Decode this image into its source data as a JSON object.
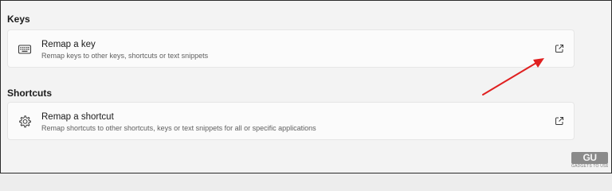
{
  "sections": {
    "keys": {
      "header": "Keys",
      "card": {
        "title": "Remap a key",
        "subtitle": "Remap keys to other keys, shortcuts or text snippets",
        "icon": "keyboard-icon",
        "action_icon": "open-external-icon"
      }
    },
    "shortcuts": {
      "header": "Shortcuts",
      "card": {
        "title": "Remap a shortcut",
        "subtitle": "Remap shortcuts to other shortcuts, keys or text snippets for all or specific applications",
        "icon": "gear-icon",
        "action_icon": "open-external-icon"
      }
    }
  },
  "annotation": {
    "color": "#e02020",
    "icon": "arrow-icon"
  },
  "watermark": {
    "logo_text": "GU",
    "sub_text": "GADGETS TO USE"
  },
  "colors": {
    "background": "#f3f3f3",
    "card": "#fbfbfb",
    "text_primary": "#1b1b1b",
    "text_secondary": "#5f5f5f"
  }
}
